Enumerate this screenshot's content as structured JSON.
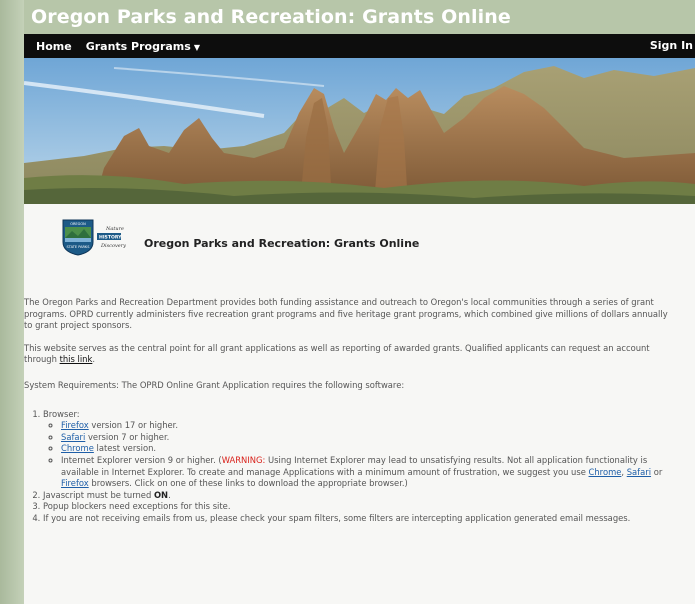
{
  "app": {
    "title": "Oregon Parks and Recreation: Grants Online"
  },
  "nav": {
    "home": "Home",
    "grants_programs": "Grants Programs",
    "sign_in": "Sign In"
  },
  "hero": {
    "image": "mountain-landscape"
  },
  "logo": {
    "line1": "Nature",
    "line2": "HISTORY",
    "line3": "Discovery",
    "seal_top": "OREGON",
    "seal_bottom": "STATE PARKS",
    "heading": "Oregon Parks and Recreation: Grants Online"
  },
  "content": {
    "p1": "The Oregon Parks and Recreation Department provides both funding assistance and outreach to Oregon's local communities through a series of grant programs. OPRD currently administers five recreation grant programs and five heritage grant programs, which combined give millions of dollars annually to grant project sponsors.",
    "p2_before": "This website serves as the central point for all grant applications as well as reporting of awarded grants. Qualified applicants can request an account through ",
    "p2_link": "this link",
    "p2_after": ".",
    "p3": "System Requirements: The OPRD Online Grant Application requires the following software:",
    "req1": "Browser:",
    "firefox_link": "Firefox",
    "firefox_text": " version 17 or higher.",
    "safari_link": "Safari",
    "safari_text": " version 7 or higher.",
    "chrome_link": "Chrome",
    "chrome_text": " latest version.",
    "ie_before": "Internet Explorer version 9 or higher. (",
    "ie_warning": "WARNING:",
    "ie_mid": " Using Internet Explorer may lead to unsatisfying results. Not all application functionality is available in Internet Explorer. To create and manage Applications with a minimum amount of frustration, we suggest you use ",
    "ie_chrome": "Chrome",
    "ie_comma": ", ",
    "ie_safari": "Safari",
    "ie_or": " or ",
    "ie_firefox": "Firefox",
    "ie_after": " browsers. Click on one of these links to download the appropriate browser.)",
    "req2_before": "Javascript must be turned ",
    "req2_on": "ON",
    "req2_after": ".",
    "req3": "Popup blockers need exceptions for this site.",
    "req4": "If you are not receiving emails from us, please check your spam filters, some filters are intercepting application generated email messages."
  }
}
